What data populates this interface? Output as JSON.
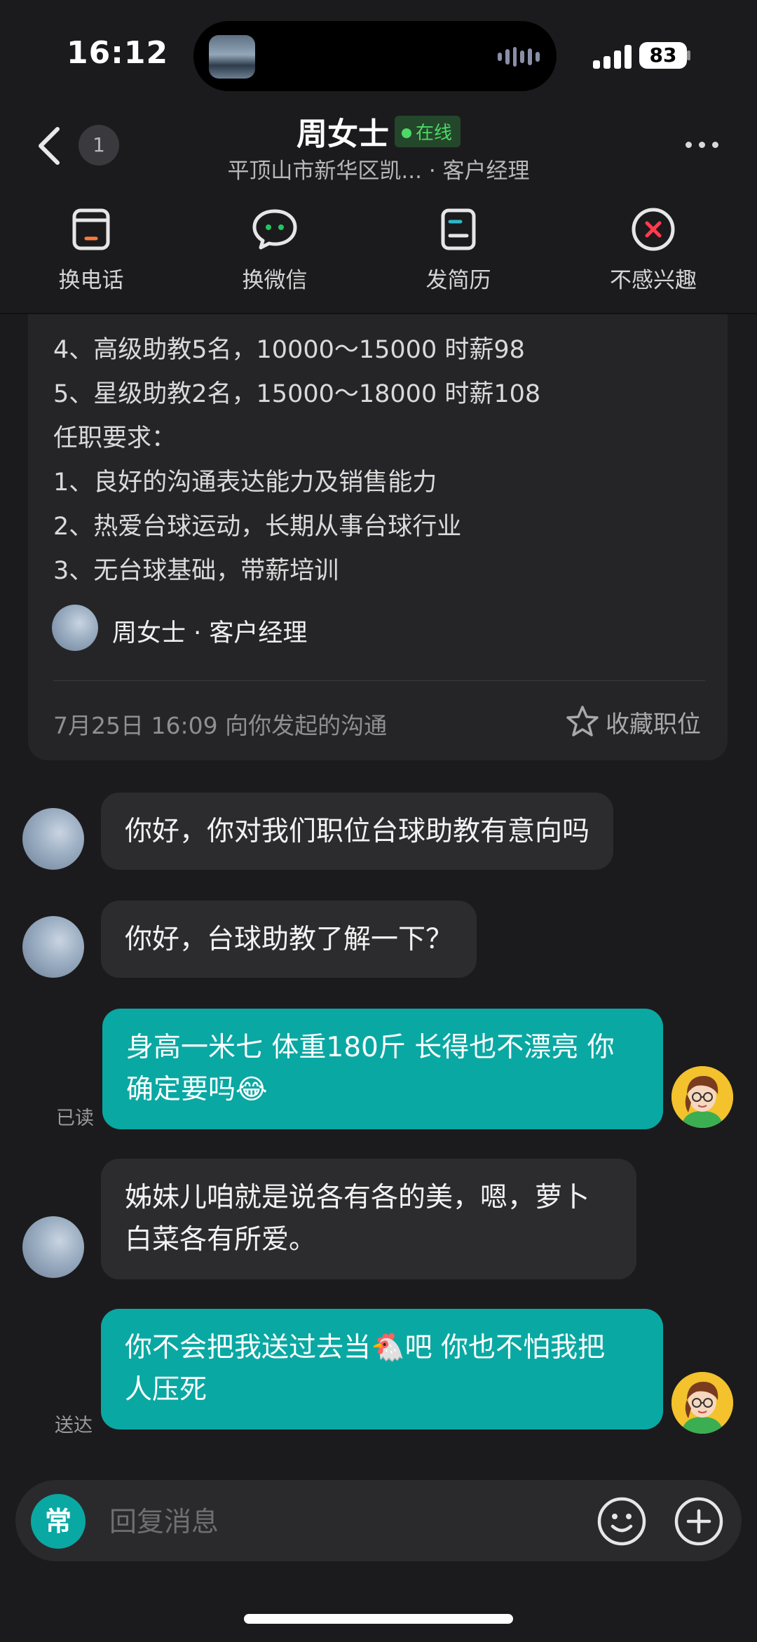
{
  "status": {
    "time": "16:12",
    "battery": "83"
  },
  "header": {
    "unread_count": "1",
    "contact_name": "周女士",
    "online_label": "在线",
    "subtitle": "平顶山市新华区凯... · 客户经理"
  },
  "actions": [
    {
      "label": "换电话",
      "icon": "phone-card-icon"
    },
    {
      "label": "换微信",
      "icon": "wechat-icon"
    },
    {
      "label": "发简历",
      "icon": "resume-icon"
    },
    {
      "label": "不感兴趣",
      "icon": "not-interested-icon"
    }
  ],
  "job_card": {
    "lines": [
      "4、高级助教5名，10000～15000   时薪98",
      "5、星级助教2名，15000～18000   时薪108",
      "任职要求：",
      "1、良好的沟通表达能力及销售能力",
      "2、热爱台球运动，长期从事台球行业",
      "3、无台球基础，带薪培训"
    ],
    "author": "周女士 · 客户经理",
    "initiated": "7月25日 16:09 向你发起的沟通",
    "favorite_label": "收藏职位"
  },
  "messages": [
    {
      "side": "in",
      "text": "你好，你对我们职位台球助教有意向吗"
    },
    {
      "side": "in",
      "text": "你好，台球助教了解一下？"
    },
    {
      "side": "out",
      "line1": "身高一米七 体重180斤 长得也不漂亮 你",
      "line2": "确定要吗",
      "emoji": "😂",
      "receipt": "已读"
    },
    {
      "side": "in",
      "line1": "姊妹儿咱就是说各有各的美，嗯，萝卜",
      "line2": "白菜各有所爱。"
    },
    {
      "side": "out",
      "line1a": "你不会把我送过去当",
      "emoji": "🐔",
      "line1b": "吧 你也不怕我把",
      "line2": "人压死",
      "receipt": "送达"
    }
  ],
  "composer": {
    "common_label": "常",
    "placeholder": "回复消息"
  },
  "colors": {
    "accent": "#0aa8a3",
    "online": "#4cd964",
    "background": "#1b1b1d"
  }
}
